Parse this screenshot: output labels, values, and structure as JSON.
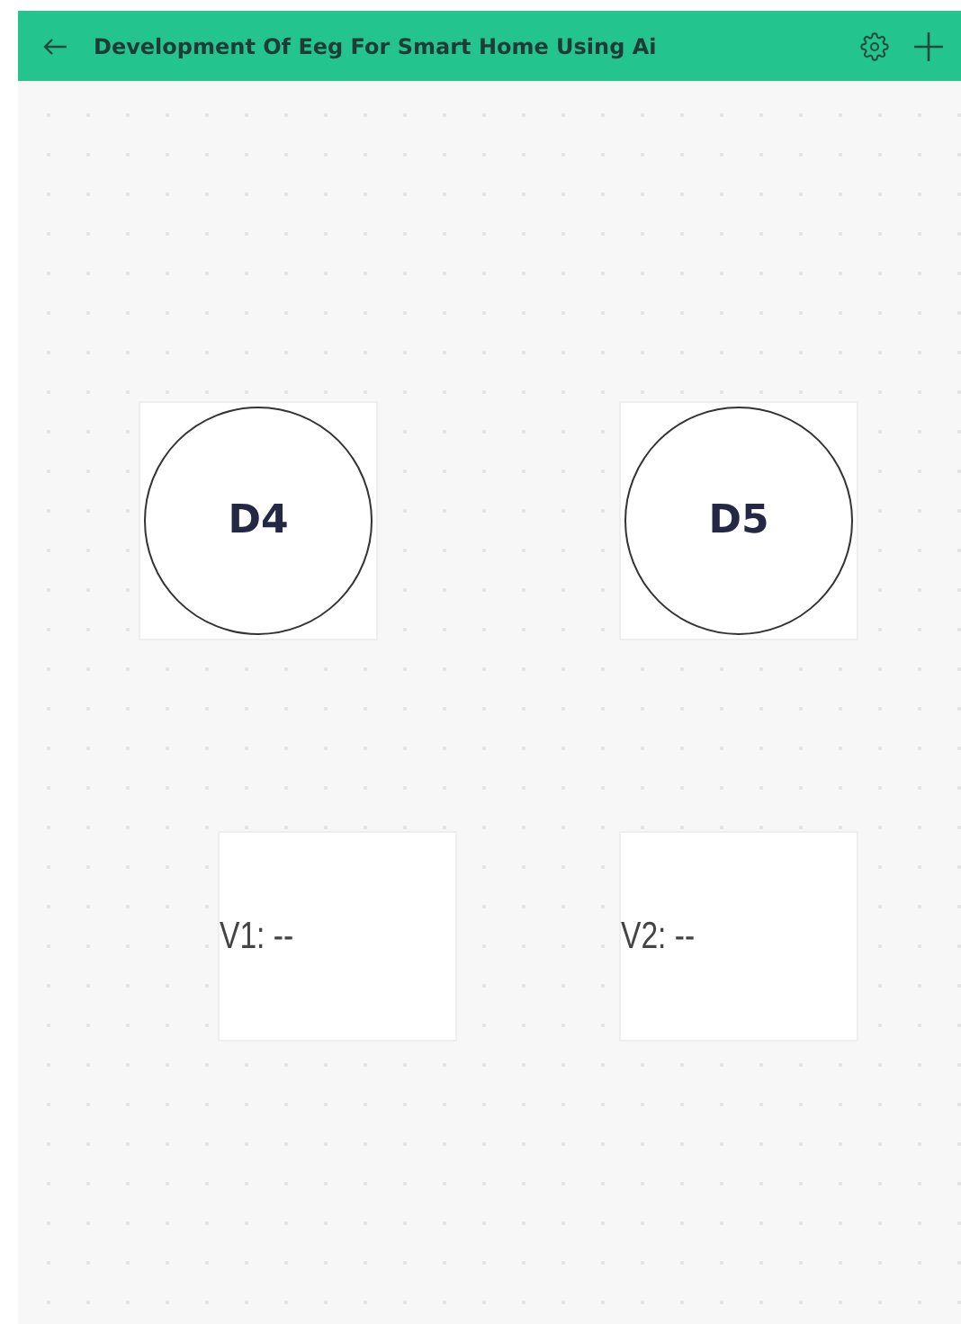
{
  "header": {
    "title": "Development Of Eeg For Smart Home Using Ai"
  },
  "buttons": [
    {
      "label": "D4"
    },
    {
      "label": "D5"
    }
  ],
  "displays": [
    {
      "label": "V1:",
      "value": "--"
    },
    {
      "label": "V2:",
      "value": "--"
    }
  ]
}
